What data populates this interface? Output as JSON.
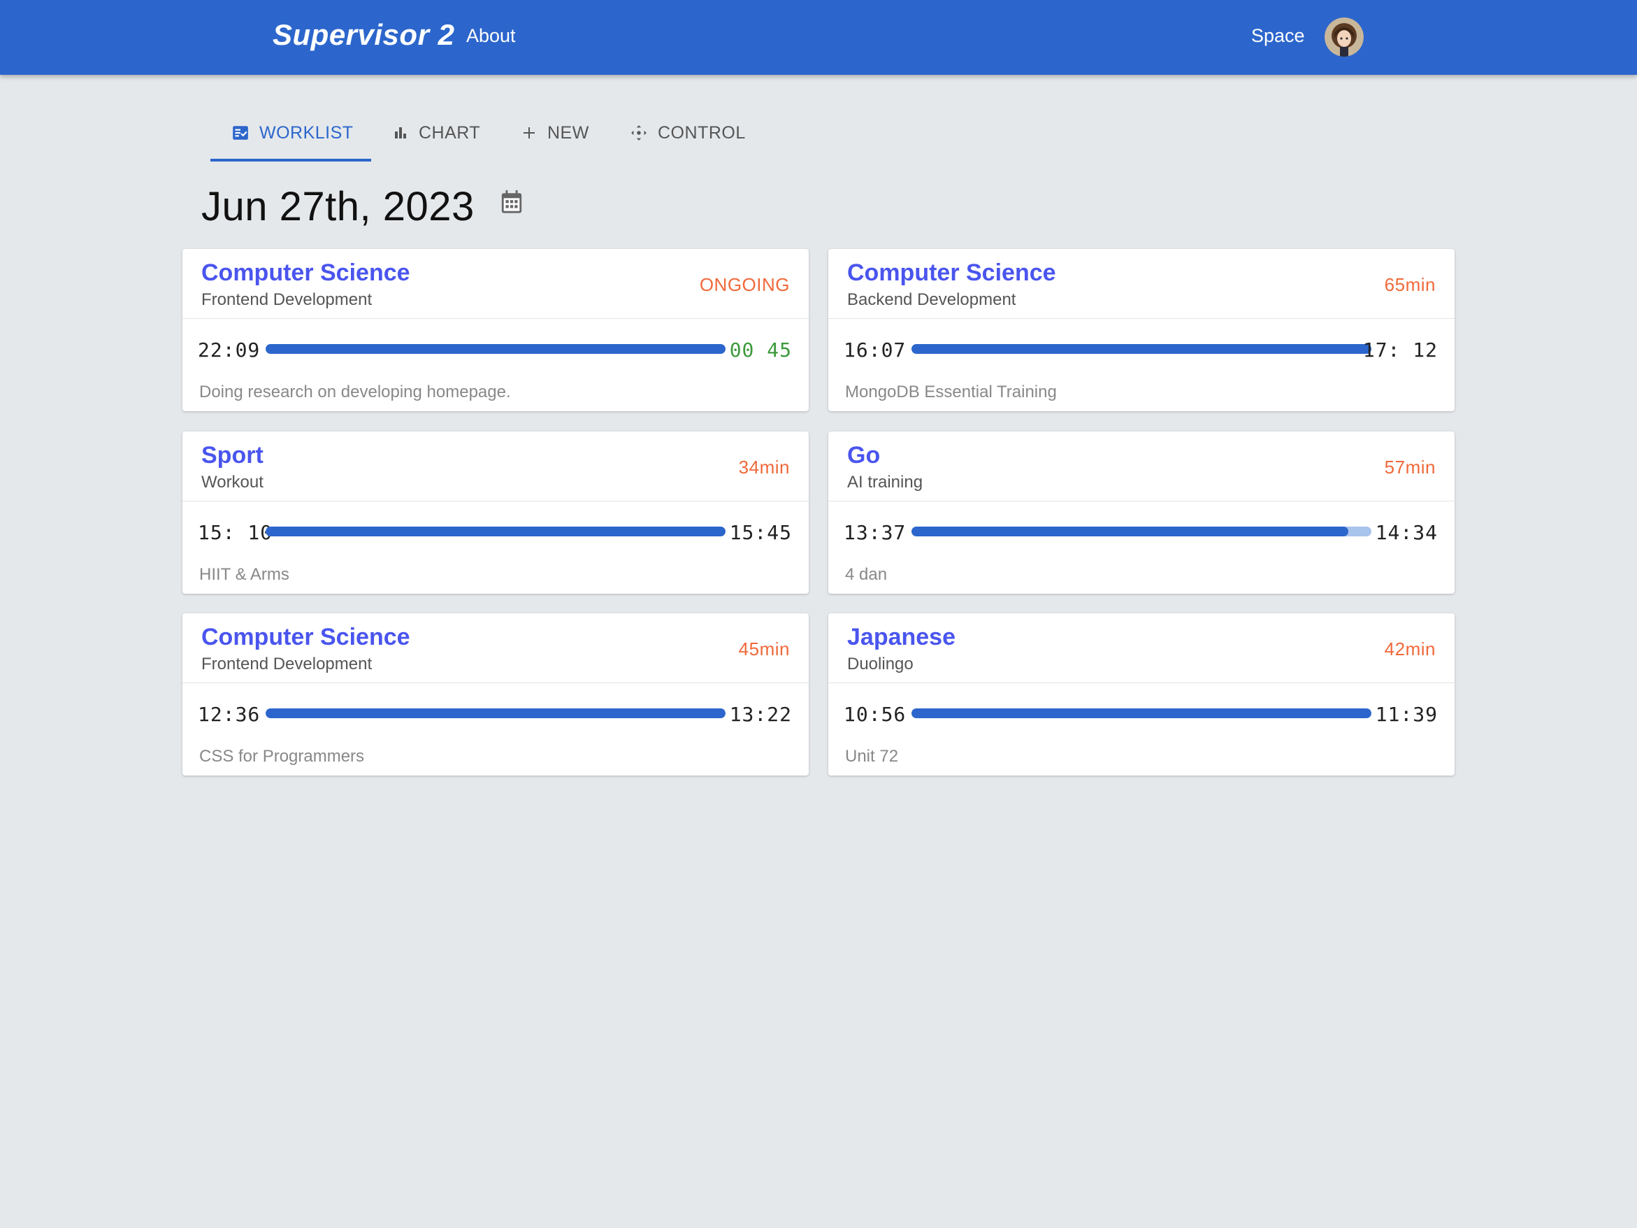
{
  "header": {
    "brand": "Supervisor 2",
    "about": "About",
    "user": "Space",
    "colors": {
      "bar": "#2c66cc"
    }
  },
  "tabs": [
    {
      "label": "WORKLIST",
      "icon": "worklist-icon",
      "active": true
    },
    {
      "label": "CHART",
      "icon": "bar-chart-icon",
      "active": false
    },
    {
      "label": "NEW",
      "icon": "plus-icon",
      "active": false
    },
    {
      "label": "CONTROL",
      "icon": "move-control-icon",
      "active": false
    }
  ],
  "date": {
    "label": "Jun 27th, 2023",
    "icon": "calendar-icon"
  },
  "cards": [
    {
      "title": "Computer Science",
      "subtitle": "Frontend Development",
      "status": "ONGOING",
      "start": "22:09",
      "end": "00 45",
      "progress": 1.0,
      "note": "Doing research on developing homepage.",
      "live": true
    },
    {
      "title": "Computer Science",
      "subtitle": "Backend Development",
      "status": "65min",
      "start": "16:07",
      "end": "17: 12",
      "progress": 1.0,
      "note": "MongoDB Essential Training",
      "live": false
    },
    {
      "title": "Sport",
      "subtitle": "Workout",
      "status": "34min",
      "start": "15: 10",
      "end": "15:45",
      "progress": 1.0,
      "note": "HIIT & Arms",
      "live": false
    },
    {
      "title": "Go",
      "subtitle": "AI training",
      "status": "57min",
      "start": "13:37",
      "end": "14:34",
      "progress": 0.95,
      "note": "4 dan",
      "live": false
    },
    {
      "title": "Computer Science",
      "subtitle": "Frontend Development",
      "status": "45min",
      "start": "12:36",
      "end": "13:22",
      "progress": 1.0,
      "note": "CSS for Programmers",
      "live": false
    },
    {
      "title": "Japanese",
      "subtitle": "Duolingo",
      "status": "42min",
      "start": "10:56",
      "end": "11:39",
      "progress": 1.0,
      "note": "Unit 72",
      "live": false
    }
  ],
  "colors": {
    "accent": "#2c66cc",
    "title": "#4a55ee",
    "status": "#f0693a",
    "live": "#3c9a3c"
  }
}
